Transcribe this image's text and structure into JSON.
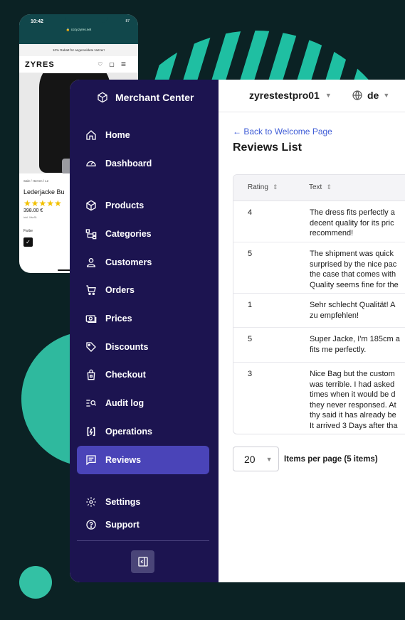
{
  "phone": {
    "time": "10:42",
    "battery": "87",
    "url": "🔒 cozy.zyres.net",
    "banner": "10% Rabatt für angemeldete Nutzer!",
    "logo": "ZYRES",
    "breadcrumb": "Sale  /  Herren  /  Le",
    "product_name": "Lederjacke Bu",
    "stars": "★★★★★",
    "price": "398.00 €",
    "tax": "inkl. MwSt.",
    "color_label": "Farbe",
    "swatch_check": "✓"
  },
  "brand": {
    "name": "Merchant Center",
    "icon": "cube-icon"
  },
  "sidebar": {
    "items": [
      {
        "label": "Home",
        "icon": "home-icon"
      },
      {
        "label": "Dashboard",
        "icon": "gauge-icon"
      },
      {
        "label": "Products",
        "icon": "box-icon"
      },
      {
        "label": "Categories",
        "icon": "hierarchy-icon"
      },
      {
        "label": "Customers",
        "icon": "user-icon"
      },
      {
        "label": "Orders",
        "icon": "cart-icon"
      },
      {
        "label": "Prices",
        "icon": "money-icon"
      },
      {
        "label": "Discounts",
        "icon": "tag-icon"
      },
      {
        "label": "Checkout",
        "icon": "bag-lock-icon"
      },
      {
        "label": "Audit log",
        "icon": "list-search-icon"
      },
      {
        "label": "Operations",
        "icon": "sync-icon"
      },
      {
        "label": "Reviews",
        "icon": "message-icon",
        "active": true
      },
      {
        "label": "Settings",
        "icon": "gear-icon"
      },
      {
        "label": "Support",
        "icon": "help-icon"
      }
    ]
  },
  "topbar": {
    "store": "zyrestestpro01",
    "language": "de"
  },
  "page": {
    "back_link": "← Back to Welcome Page",
    "title": "Reviews List"
  },
  "table": {
    "columns": [
      "Rating",
      "Text"
    ],
    "rows": [
      {
        "rating": "4",
        "text": "The dress fits perfectly a\ndecent quality for its pric\nrecommend!"
      },
      {
        "rating": "5",
        "text": "The shipment was quick\nsurprised by the nice pac\nthe case that comes with\nQuality seems fine for the"
      },
      {
        "rating": "1",
        "text": "Sehr schlecht Qualität! A\nzu empfehlen!"
      },
      {
        "rating": "5",
        "text": "Super Jacke, I'm 185cm a\nfits me perfectly."
      },
      {
        "rating": "3",
        "text": "Nice Bag but the custom\nwas terrible. I had asked\ntimes when it would be d\nthey never responsed. At\nthy said it has already be\nIt arrived 3 Days after tha"
      }
    ]
  },
  "pagination": {
    "per_page": "20",
    "label": "Items per page (5 items)"
  },
  "colors": {
    "sidebar": "#1c1450",
    "active": "#4a44b8",
    "accent": "#2fb99e",
    "link": "#3d5bd6"
  }
}
